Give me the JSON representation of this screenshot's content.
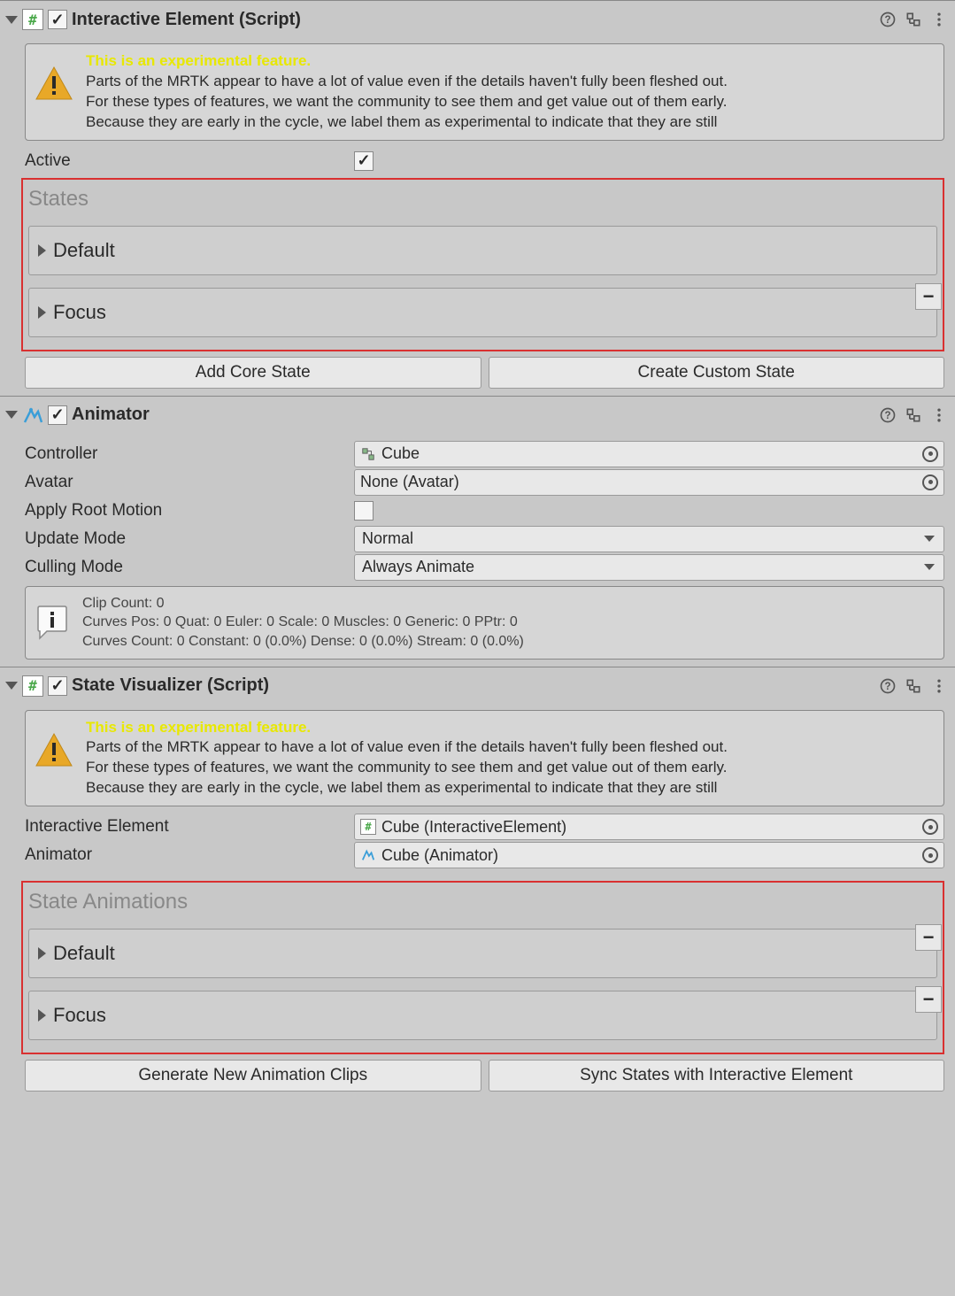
{
  "interactiveElement": {
    "title": "Interactive Element (Script)",
    "enabled": true,
    "warning": {
      "heading": "This is an experimental feature.",
      "body1": "Parts of the MRTK appear to have a lot of value even if the details haven't fully been fleshed out.",
      "body2": "For these types of features, we want the community to see them and get value out of them early.",
      "body3": "Because they are early in the cycle, we label them as experimental to indicate that they are still"
    },
    "props": {
      "activeLabel": "Active",
      "activeValue": true
    },
    "statesTitle": "States",
    "states": [
      {
        "name": "Default",
        "removable": false
      },
      {
        "name": "Focus",
        "removable": true
      }
    ],
    "buttons": {
      "addCore": "Add Core State",
      "createCustom": "Create Custom State"
    }
  },
  "animator": {
    "title": "Animator",
    "enabled": true,
    "props": {
      "controllerLabel": "Controller",
      "controllerValue": "Cube",
      "avatarLabel": "Avatar",
      "avatarValue": "None (Avatar)",
      "applyRootLabel": "Apply Root Motion",
      "applyRootValue": false,
      "updateModeLabel": "Update Mode",
      "updateModeValue": "Normal",
      "cullingModeLabel": "Culling Mode",
      "cullingModeValue": "Always Animate"
    },
    "info": {
      "line1": "Clip Count: 0",
      "line2": "Curves Pos: 0 Quat: 0 Euler: 0 Scale: 0 Muscles: 0 Generic: 0 PPtr: 0",
      "line3": "Curves Count: 0 Constant: 0 (0.0%) Dense: 0 (0.0%) Stream: 0 (0.0%)"
    }
  },
  "stateVisualizer": {
    "title": "State Visualizer (Script)",
    "enabled": true,
    "warning": {
      "heading": "This is an experimental feature.",
      "body1": "Parts of the MRTK appear to have a lot of value even if the details haven't fully been fleshed out.",
      "body2": "For these types of features, we want the community to see them and get value out of them early.",
      "body3": "Because they are early in the cycle, we label them as experimental to indicate that they are still"
    },
    "props": {
      "interactiveElementLabel": "Interactive Element",
      "interactiveElementValue": "Cube (InteractiveElement)",
      "animatorLabel": "Animator",
      "animatorValue": "Cube (Animator)"
    },
    "stateAnimsTitle": "State Animations",
    "stateAnims": [
      {
        "name": "Default",
        "removable": true
      },
      {
        "name": "Focus",
        "removable": true
      }
    ],
    "buttons": {
      "generate": "Generate New Animation Clips",
      "sync": "Sync States with Interactive Element"
    }
  }
}
